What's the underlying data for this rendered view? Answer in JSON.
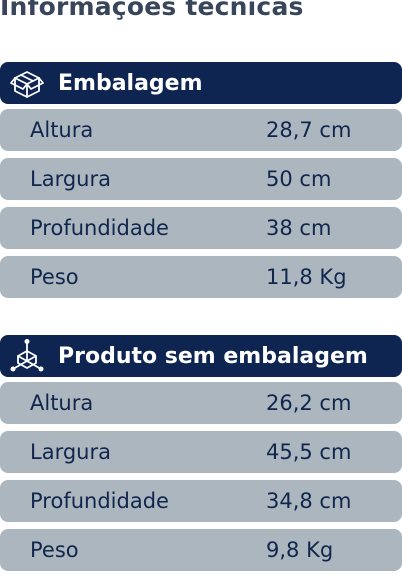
{
  "title": "Informações técnicas",
  "sections": [
    {
      "icon": "box-icon",
      "heading": "Embalagem",
      "rows": [
        {
          "label": "Altura",
          "value": "28,7 cm"
        },
        {
          "label": "Largura",
          "value": "50 cm"
        },
        {
          "label": "Profundidade",
          "value": "38 cm"
        },
        {
          "label": "Peso",
          "value": "11,8 Kg"
        }
      ]
    },
    {
      "icon": "dimensions-icon",
      "heading": "Produto sem embalagem",
      "rows": [
        {
          "label": "Altura",
          "value": "26,2 cm"
        },
        {
          "label": "Largura",
          "value": "45,5 cm"
        },
        {
          "label": "Profundidade",
          "value": "34,8 cm"
        },
        {
          "label": "Peso",
          "value": "9,8 Kg"
        }
      ]
    }
  ],
  "colors": {
    "header_bg": "#0e2451",
    "row_bg": "#acb6bf",
    "text": "#11264d",
    "title": "#39455a"
  }
}
